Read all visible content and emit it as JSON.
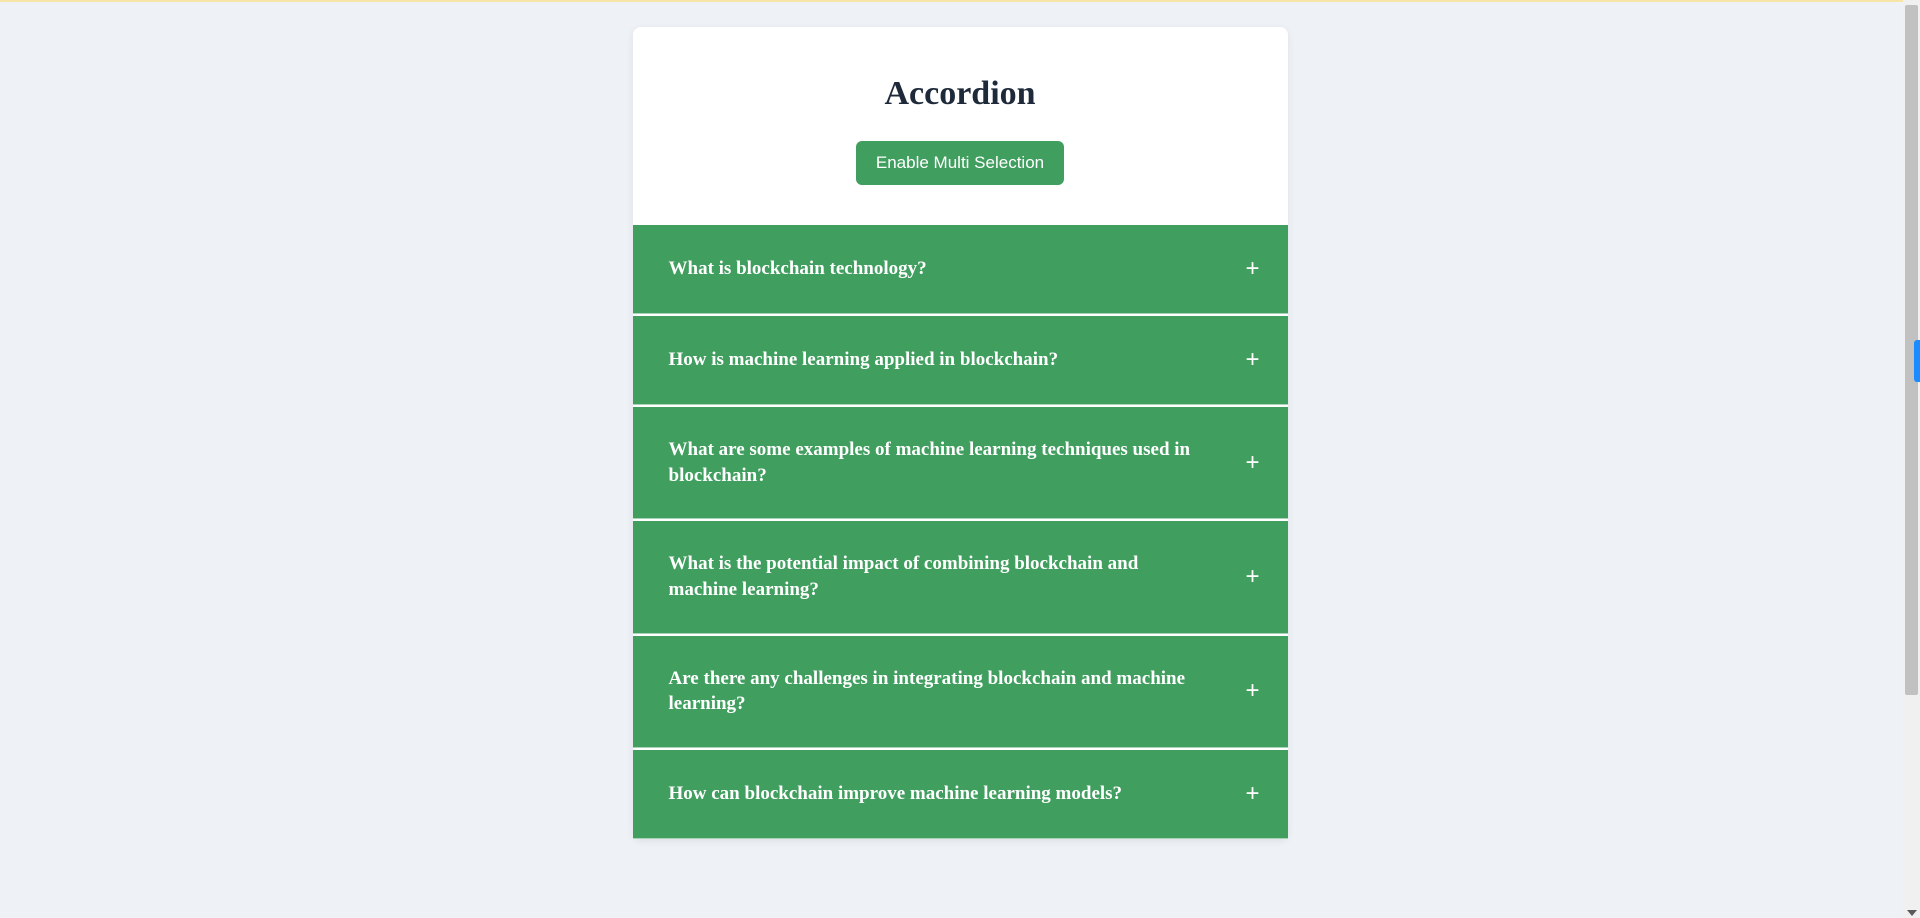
{
  "title": "Accordion",
  "button_label": "Enable Multi Selection",
  "plus_symbol": "+",
  "items": [
    {
      "question": "What is blockchain technology?"
    },
    {
      "question": "How is machine learning applied in blockchain?"
    },
    {
      "question": "What are some examples of machine learning techniques used in blockchain?"
    },
    {
      "question": "What is the potential impact of combining blockchain and machine learning?"
    },
    {
      "question": "Are there any challenges in integrating blockchain and machine learning?"
    },
    {
      "question": "How can blockchain improve machine learning models?"
    }
  ]
}
